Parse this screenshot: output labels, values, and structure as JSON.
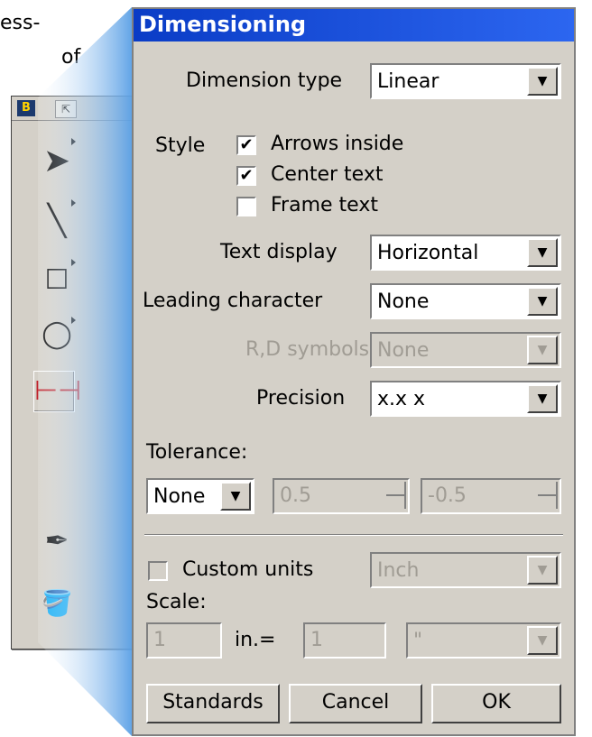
{
  "background": {
    "fragment_line1": "ess-",
    "fragment_line2": "of",
    "toolbox_logo": "B"
  },
  "dialog": {
    "title": "Dimensioning",
    "dimension_type": {
      "label": "Dimension type",
      "value": "Linear"
    },
    "style": {
      "label": "Style",
      "options": [
        {
          "label": "Arrows inside",
          "checked": true
        },
        {
          "label": "Center text",
          "checked": true
        },
        {
          "label": "Frame text",
          "checked": false
        }
      ]
    },
    "text_display": {
      "label": "Text display",
      "value": "Horizontal"
    },
    "leading_character": {
      "label": "Leading character",
      "value": "None"
    },
    "rd_symbols": {
      "label": "R,D symbols",
      "value": "None",
      "enabled": false
    },
    "precision": {
      "label": "Precision",
      "value": "x.x x"
    },
    "tolerance": {
      "label": "Tolerance:",
      "type_value": "None",
      "upper": "0.5",
      "lower": "-0.5"
    },
    "custom_units": {
      "label": "Custom units",
      "checked": false,
      "unit_value": "Inch"
    },
    "scale": {
      "label": "Scale:",
      "left_value": "1",
      "middle_label": "in.=",
      "right_value": "1",
      "unit_value": "\""
    },
    "buttons": {
      "standards": "Standards",
      "cancel": "Cancel",
      "ok": "OK"
    }
  },
  "icons": {
    "check_glyph": "✔",
    "arrow_glyph": "▼"
  }
}
